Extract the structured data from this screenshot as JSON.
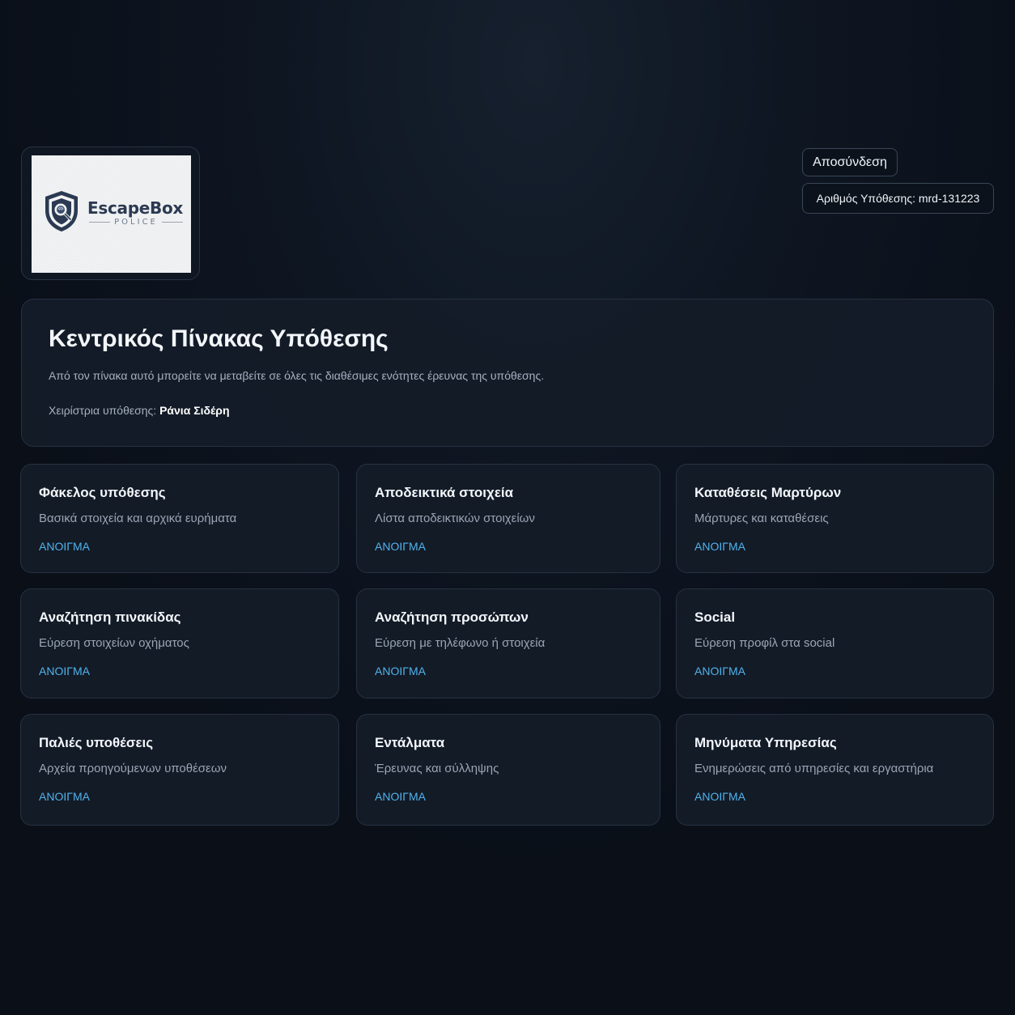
{
  "logo": {
    "brand_name": "EscapeBox",
    "brand_sub": "POLICE",
    "icon": "shield-magnifier-icon",
    "colors": {
      "navy": "#2b3a52",
      "slate": "#6e7c90"
    }
  },
  "header": {
    "logout_label": "Αποσύνδεση",
    "case_number_label": "Αριθμός Υπόθεσης: mrd-131223"
  },
  "hero": {
    "title": "Κεντρικός Πίνακας Υπόθεσης",
    "description": "Από τον πίνακα αυτό μπορείτε να μεταβείτε σε όλες τις διαθέσιμες ενότητες έρευνας της υπόθεσης.",
    "manager_label": "Χειρίστρια υπόθεσης:",
    "manager_name": "Ράνια Σιδέρη"
  },
  "cards": [
    {
      "title": "Φάκελος υπόθεσης",
      "description": "Βασικά στοιχεία και αρχικά ευρήματα",
      "action": "ΑΝΟΙΓΜΑ"
    },
    {
      "title": "Αποδεικτικά στοιχεία",
      "description": "Λίστα αποδεικτικών στοιχείων",
      "action": "ΑΝΟΙΓΜΑ"
    },
    {
      "title": "Καταθέσεις Μαρτύρων",
      "description": "Μάρτυρες και καταθέσεις",
      "action": "ΑΝΟΙΓΜΑ"
    },
    {
      "title": "Αναζήτηση πινακίδας",
      "description": "Εύρεση στοιχείων οχήματος",
      "action": "ΑΝΟΙΓΜΑ"
    },
    {
      "title": "Αναζήτηση προσώπων",
      "description": "Εύρεση με τηλέφωνο ή στοιχεία",
      "action": "ΑΝΟΙΓΜΑ"
    },
    {
      "title": "Social",
      "description": "Εύρεση προφίλ στα social",
      "action": "ΑΝΟΙΓΜΑ"
    },
    {
      "title": "Παλιές υποθέσεις",
      "description": "Αρχεία προηγούμενων υποθέσεων",
      "action": "ΑΝΟΙΓΜΑ"
    },
    {
      "title": "Εντάλματα",
      "description": "Έρευνας και σύλληψης",
      "action": "ΑΝΟΙΓΜΑ"
    },
    {
      "title": "Μηνύματα Υπηρεσίας",
      "description": "Ενημερώσεις από υπηρεσίες και εργαστήρια",
      "action": "ΑΝΟΙΓΜΑ"
    }
  ],
  "theme": {
    "background": "#0b111b",
    "card_background": "#131b27",
    "link_color": "#4fb3ec"
  }
}
